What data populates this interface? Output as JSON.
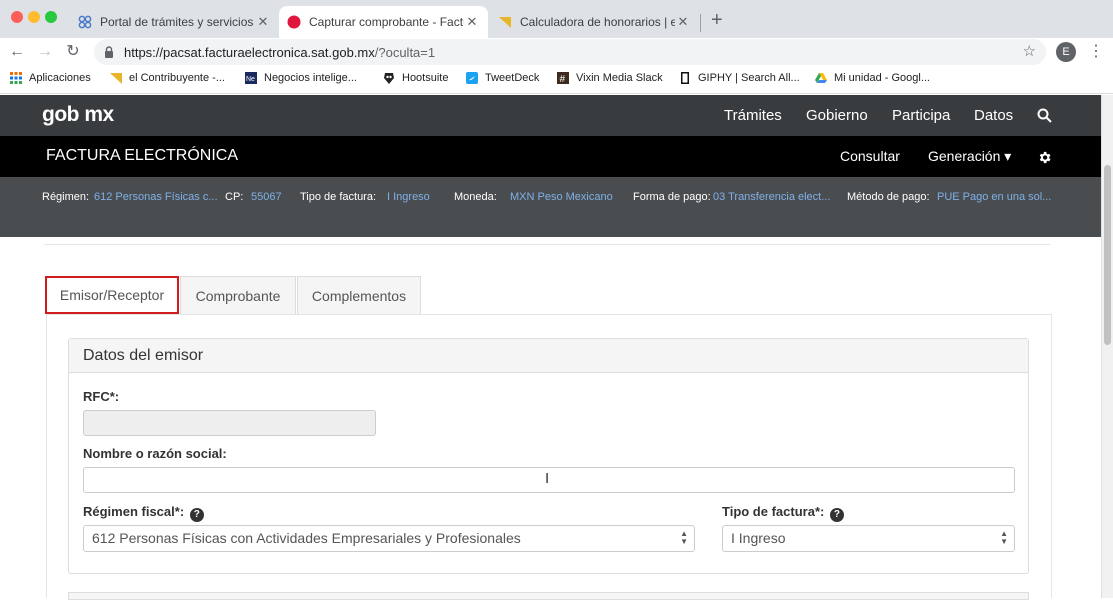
{
  "browser": {
    "tabs": [
      {
        "title": "Portal de trámites y servicios -",
        "icon": "gear-cluster-icon"
      },
      {
        "title": "Capturar comprobante - Factura",
        "icon": "red-dot-icon"
      },
      {
        "title": "Calculadora de honorarios | el",
        "icon": "yellow-flag-icon"
      }
    ],
    "new_tab": "+",
    "url_main": "https://pacsat.facturaelectronica.sat.gob.mx",
    "url_rest": "/?oculta=1",
    "profile_initial": "E"
  },
  "bookmarks": [
    {
      "label": "Aplicaciones",
      "icon": "apps-grid-icon"
    },
    {
      "label": "el Contribuyente -...",
      "icon": "yellow-flag-icon"
    },
    {
      "label": "Negocios intelige...",
      "icon": "news-icon"
    },
    {
      "label": "Hootsuite",
      "icon": "owl-icon"
    },
    {
      "label": "TweetDeck",
      "icon": "tweetdeck-icon"
    },
    {
      "label": "Vixin Media Slack",
      "icon": "hash-icon"
    },
    {
      "label": "GIPHY | Search All...",
      "icon": "giphy-icon"
    },
    {
      "label": "Mi unidad - Googl...",
      "icon": "drive-icon"
    }
  ],
  "gob": {
    "logo": "gob mx",
    "nav": [
      "Trámites",
      "Gobierno",
      "Participa",
      "Datos"
    ]
  },
  "factura": {
    "brand": "FACTURA ELECTRÓNICA",
    "consultar": "Consultar",
    "generacion": "Generación ▾"
  },
  "info": {
    "regimen_label": "Régimen:",
    "regimen_value": "612 Personas Físicas c...",
    "cp_label": "CP:",
    "cp_value": "55067",
    "tipo_label": "Tipo de factura:",
    "tipo_value": "I Ingreso",
    "moneda_label": "Moneda:",
    "moneda_value": "MXN Peso Mexicano",
    "forma_label": "Forma de pago:",
    "forma_value": "03 Transferencia elect...",
    "metodo_label": "Método de pago:",
    "metodo_value": "PUE Pago en una sol..."
  },
  "form_tabs": [
    "Emisor/Receptor",
    "Comprobante",
    "Complementos"
  ],
  "emisor": {
    "title": "Datos del emisor",
    "rfc_label": "RFC*:",
    "rfc_value": "",
    "nombre_label": "Nombre o razón social:",
    "nombre_value": "",
    "regimen_label": "Régimen fiscal*:",
    "regimen_value": "612 Personas Físicas con Actividades Empresariales y Profesionales",
    "tipo_label": "Tipo de factura*:",
    "tipo_value": "I Ingreso"
  },
  "colors": {
    "active_tab_border": "#d01c1c",
    "link_blue": "#7fb0e8",
    "gob_gray": "#393c3e"
  }
}
